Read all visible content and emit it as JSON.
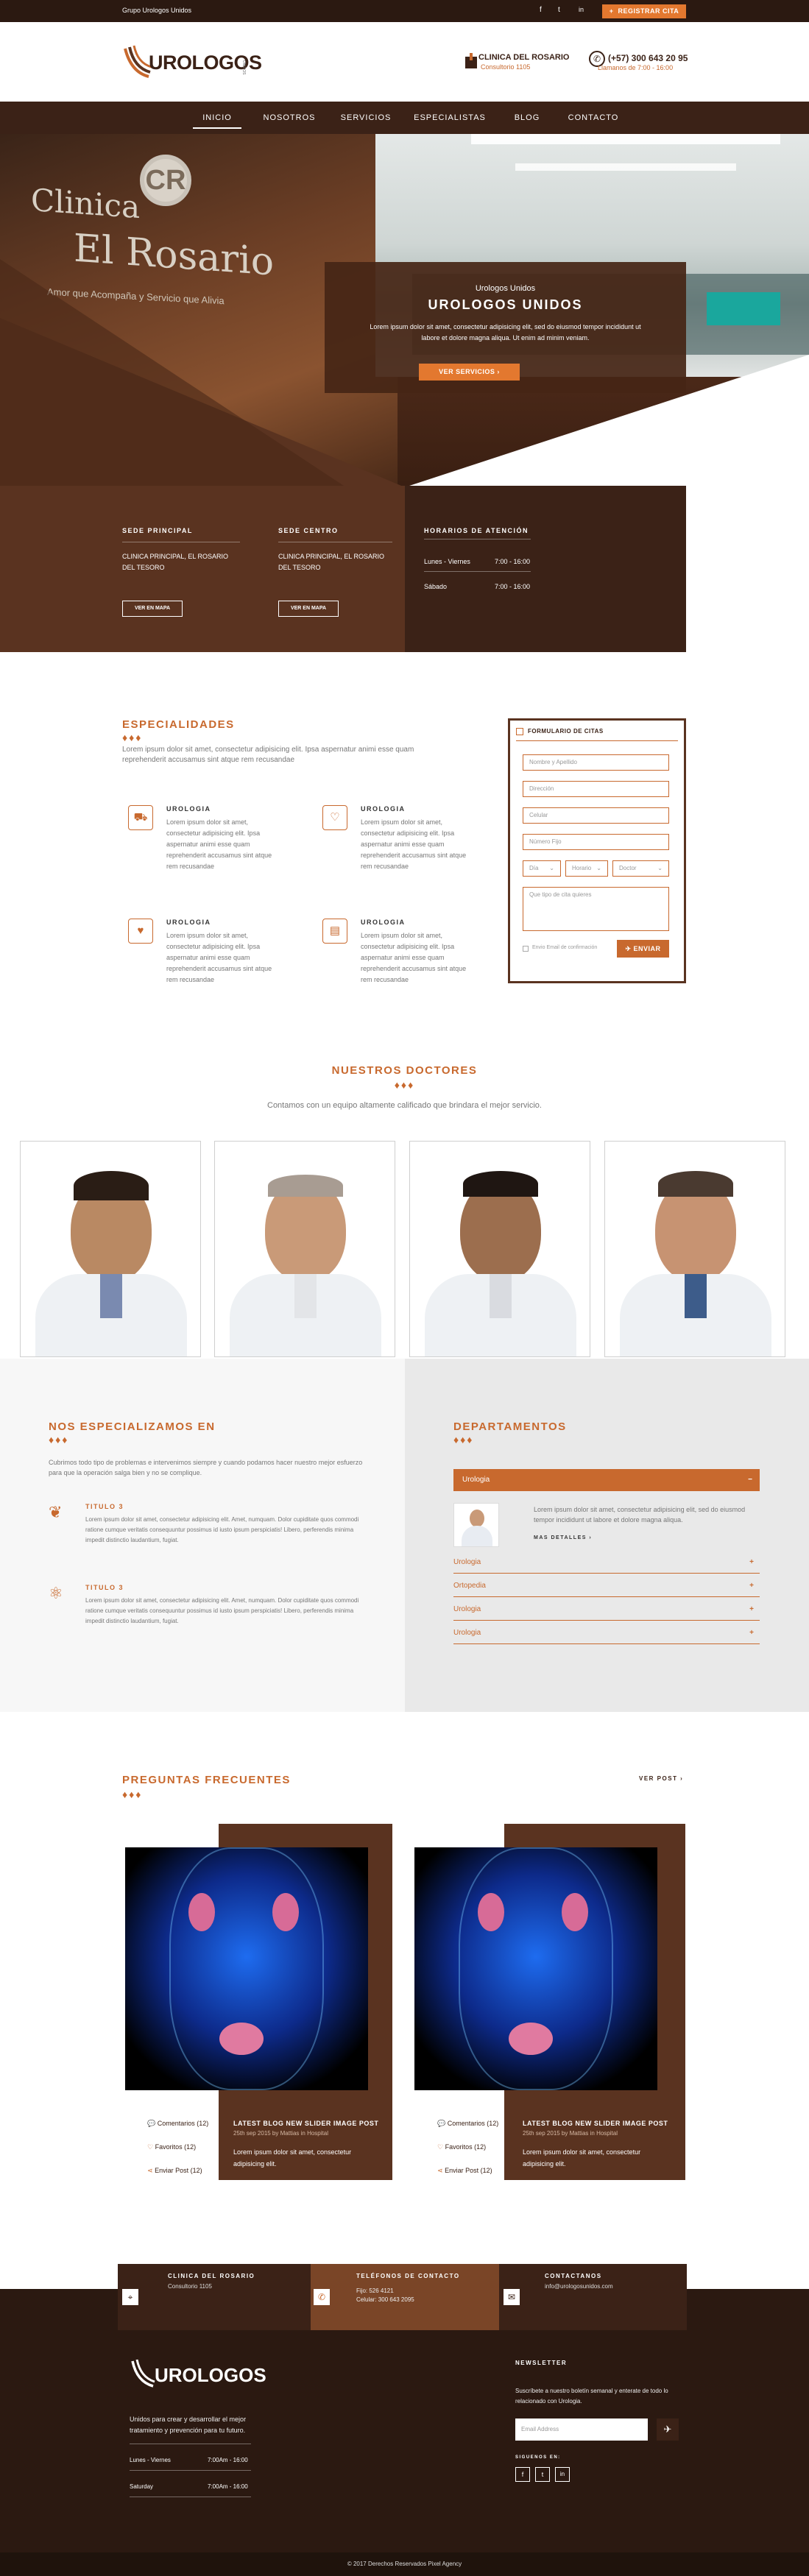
{
  "topbar": {
    "brand": "Grupo Urologos Unidos",
    "cta": "REGISTRAR CITA"
  },
  "header": {
    "logo": "UROLOGOS",
    "logo_sub": "UNIDOS",
    "clinic_name": "CLINICA DEL ROSARIO",
    "clinic_sub": "Consultorio 1105",
    "phone": "(+57) 300 643 20 95",
    "hours": "Llamanos de 7:00 - 16:00"
  },
  "nav": [
    "INICIO",
    "NOSOTROS",
    "SERVICIOS",
    "ESPECIALISTAS",
    "BLOG",
    "CONTACTO"
  ],
  "hero": {
    "sign_line1": "Clinica",
    "sign_line2": "El Rosario",
    "sign_tag": "Amor que Acompaña y Servicio que Alivia",
    "kicker": "Urologos Unidos",
    "title": "UROLOGOS UNIDOS",
    "text": "Lorem ipsum dolor sit amet, consectetur adipisicing elit, sed do eiusmod tempor incididunt ut labore et dolore magna aliqua. Ut enim ad minim veniam.",
    "button": "VER SERVICIOS"
  },
  "locations": [
    {
      "title": "SEDE PRINCIPAL",
      "text": "CLINICA PRINCIPAL, EL ROSARIO DEL TESORO",
      "button": "VER EN MAPA"
    },
    {
      "title": "SEDE CENTRO",
      "text": "CLINICA PRINCIPAL, EL ROSARIO DEL TESORO",
      "button": "VER EN MAPA"
    }
  ],
  "hours": {
    "title": "HORARIOS DE ATENCIÓN",
    "rows": [
      {
        "day": "Lunes - Viernes",
        "time": "7:00 - 16:00"
      },
      {
        "day": "Sábado",
        "time": "7:00 - 16:00"
      }
    ]
  },
  "especialidades": {
    "title": "ESPECIALIDADES",
    "intro": "Lorem ipsum dolor sit amet, consectetur adipisicing elit. Ipsa aspernatur animi esse quam reprehenderit accusamus sint atque rem recusandae",
    "items": [
      {
        "title": "UROLOGIA",
        "text": "Lorem ipsum dolor sit amet, consectetur adipisicing elit. Ipsa aspernatur animi esse quam reprehenderit accusamus sint atque rem recusandae"
      },
      {
        "title": "UROLOGIA",
        "text": "Lorem ipsum dolor sit amet, consectetur adipisicing elit. Ipsa aspernatur animi esse quam reprehenderit accusamus sint atque rem recusandae"
      },
      {
        "title": "UROLOGIA",
        "text": "Lorem ipsum dolor sit amet, consectetur adipisicing elit. Ipsa aspernatur animi esse quam reprehenderit accusamus sint atque rem recusandae"
      },
      {
        "title": "UROLOGIA",
        "text": "Lorem ipsum dolor sit amet, consectetur adipisicing elit. Ipsa aspernatur animi esse quam reprehenderit accusamus sint atque rem recusandae"
      }
    ]
  },
  "form": {
    "title": "FORMULARIO DE CITAS",
    "name": "Nombre y Apellido",
    "address": "Dirección",
    "cell": "Celular",
    "phone": "Número Fijo",
    "day": "Día",
    "time": "Horario",
    "doctor": "Doctor",
    "message": "Que tipo de cita quieres",
    "checkbox": "Envio Email de confirmación",
    "submit": "ENVIAR"
  },
  "doctors": {
    "title": "NUESTROS DOCTORES",
    "subtitle": "Contamos con un equipo altamente calificado que brindara el mejor servicio."
  },
  "specialize": {
    "title": "NOS ESPECIALIZAMOS EN",
    "intro": "Cubrimos todo tipo de problemas e intervenimos siempre y cuando podamos hacer nuestro mejor esfuerzo para que la operación salga bien y no se complique.",
    "items": [
      {
        "title": "TITULO 3",
        "text": "Lorem ipsum dolor sit amet, consectetur adipisicing elit. Amet, numquam. Dolor cupiditate quos commodi ratione cumque veritatis consequuntur possimus id iusto ipsum perspiciatis! Libero, perferendis minima impedit distinctio laudantium, fugiat."
      },
      {
        "title": "TITULO 3",
        "text": "Lorem ipsum dolor sit amet, consectetur adipisicing elit. Amet, numquam. Dolor cupiditate quos commodi ratione cumque veritatis consequuntur possimus id iusto ipsum perspiciatis! Libero, perferendis minima impedit distinctio laudantium, fugiat."
      }
    ]
  },
  "departamentos": {
    "title": "DEPARTAMENTOS",
    "active": "Urologia",
    "active_text": "Lorem ipsum dolor sit amet, consectetur adipisicing elit, sed do eiusmod tempor incididunt ut labore et dolore magna aliqua.",
    "more": "MAS DETALLES",
    "items": [
      "Urologia",
      "Ortopedia",
      "Urologia",
      "Urologia"
    ]
  },
  "faq": {
    "title": "PREGUNTAS FRECUENTES",
    "more": "VER POST",
    "posts": [
      {
        "comments": "Comentarios (12)",
        "favs": "Favoritos (12)",
        "send": "Enviar Post (12)",
        "title": "LATEST BLOG NEW SLIDER IMAGE POST",
        "date": "25th sep 2015 by Mattias in Hospital",
        "text": "Lorem ipsum dolor sit amet, consectetur adipisicing elit."
      },
      {
        "comments": "Comentarios (12)",
        "favs": "Favoritos (12)",
        "send": "Enviar Post (12)",
        "title": "LATEST BLOG NEW SLIDER IMAGE POST",
        "date": "25th sep 2015 by Mattias in Hospital",
        "text": "Lorem ipsum dolor sit amet, consectetur adipisicing elit."
      }
    ]
  },
  "contact_strip": [
    {
      "title": "CLINICA DEL ROSARIO",
      "line1": "Consultorio 1105",
      "line2": ""
    },
    {
      "title": "TELÉFONOS DE CONTACTO",
      "line1": "Fijo: 526 4121",
      "line2": "Celular: 300 643 2095"
    },
    {
      "title": "CONTACTANOS",
      "line1": "info@urologosunidos.com",
      "line2": ""
    }
  ],
  "footer": {
    "logo": "UROLOGOS",
    "about": "Unidos para crear y desarrollar el mejor tratamiento y prevención para tu futuro.",
    "hours": [
      {
        "day": "Lunes - Viernes",
        "time": "7:00Am - 16:00"
      },
      {
        "day": "Saturday",
        "time": "7:00Am - 16:00"
      }
    ],
    "newsletter_title": "NEWSLETTER",
    "newsletter_text": "Suscríbete a nuestro boletín semanal y enterate de todo lo relacionado con Urologia.",
    "email_placeholder": "Email Address",
    "social_title": "SIGUENOS EN:",
    "copyright": "© 2017 Derechos Reservados Pixel Agency"
  },
  "colors": {
    "brown": "#5a3320",
    "orange": "#c8692e",
    "dark": "#2b1911"
  }
}
